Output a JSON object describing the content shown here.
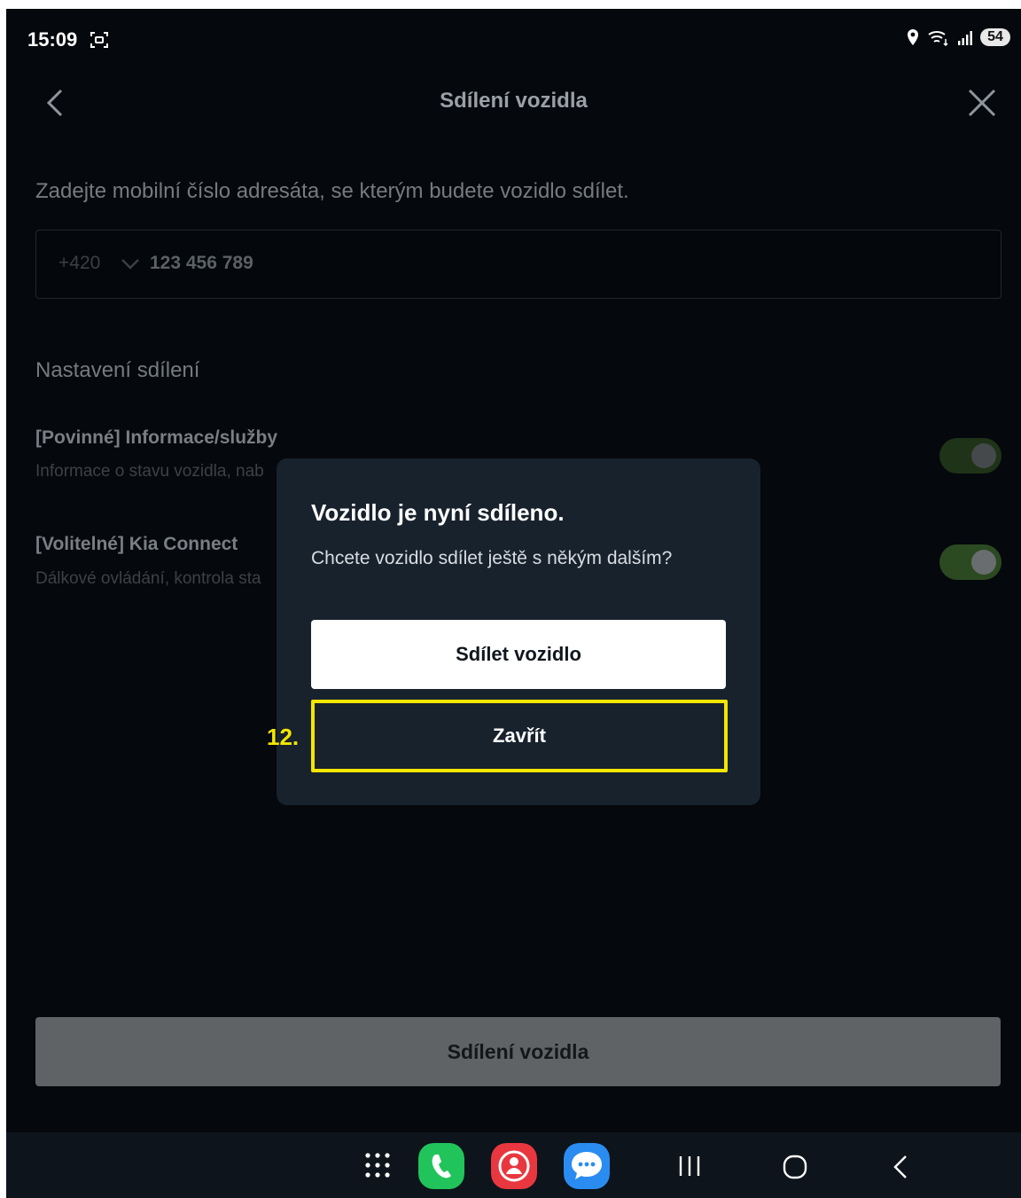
{
  "status_bar": {
    "time": "15:09",
    "battery": "54"
  },
  "header": {
    "title": "Sdílení vozidla"
  },
  "form": {
    "instruction": "Zadejte mobilní číslo adresáta, se kterým budete vozidlo sdílet.",
    "country_code": "+420",
    "phone_value": "123 456 789"
  },
  "settings": {
    "title": "Nastavení sdílení",
    "options": [
      {
        "title": "[Povinné] Informace/služby",
        "desc": "Informace o stavu vozidla, nab",
        "enabled": true
      },
      {
        "title": "[Volitelné] Kia Connect",
        "desc": "Dálkové ovládání, kontrola sta",
        "enabled": true
      }
    ]
  },
  "share_button": "Sdílení vozidla",
  "dialog": {
    "title": "Vozidlo je nyní sdíleno.",
    "message": "Chcete vozidlo sdílet ještě s někým dalším?",
    "primary": "Sdílet vozidlo",
    "secondary": "Zavřít"
  },
  "annotation": {
    "step": "12."
  },
  "colors": {
    "highlight": "#f3e600",
    "phone_icon": "#21c45a",
    "contacts_icon": "#e8373f",
    "messages_icon": "#2a8cf0"
  },
  "navbar": {
    "icons": [
      "apps-grid-icon",
      "phone-icon",
      "contacts-icon",
      "messages-icon",
      "recents-icon",
      "home-icon",
      "back-icon"
    ]
  }
}
